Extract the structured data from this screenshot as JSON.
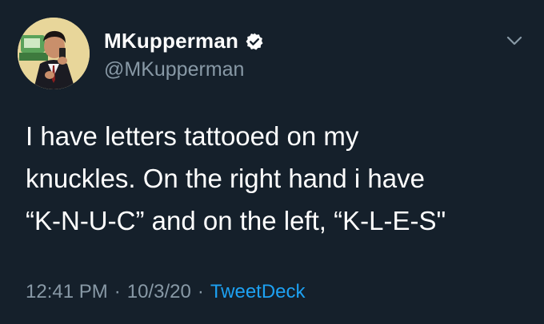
{
  "user": {
    "display_name": "MKupperman",
    "handle": "@MKupperman",
    "verified": true,
    "avatar_icon": "avatar-illustration"
  },
  "tweet": {
    "lines": [
      "I have letters tattooed on my",
      "knuckles. On the right hand i have",
      "“K-N-U-C” and on the left, “K-L-E-S\""
    ]
  },
  "meta": {
    "time": "12:41 PM",
    "separator": "·",
    "date": "10/3/20",
    "source": "TweetDeck"
  },
  "colors": {
    "background": "#15202b",
    "text": "#ffffff",
    "secondary": "#8899a6",
    "accent": "#1da1f2"
  },
  "icons": {
    "verified": "verified-badge-icon",
    "menu": "chevron-down-icon"
  }
}
